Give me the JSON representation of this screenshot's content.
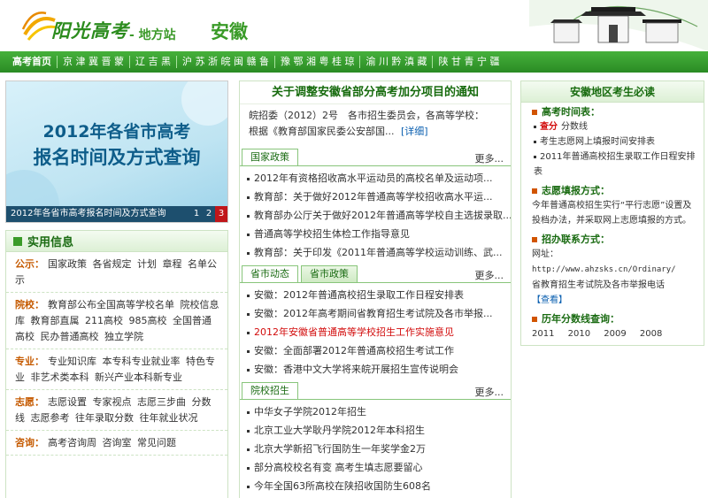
{
  "header": {
    "logo_text": "阳光高考",
    "logo_sub": "- 地方站",
    "province": "安徽"
  },
  "nav": [
    "高考首页",
    "京 津 冀 晋 蒙",
    "辽 吉 黑",
    "沪 苏 浙 皖 闽 赣 鲁",
    "豫 鄂 湘 粤 桂 琼",
    "渝 川 黔 滇 藏",
    "陕 甘 青 宁 疆"
  ],
  "banner": {
    "line1": "2012年各省市高考",
    "line2": "报名时间及方式查询",
    "caption": "2012年各省市高考报名时间及方式查询",
    "pages": [
      "1",
      "2",
      "3"
    ],
    "active_page": 3
  },
  "info": {
    "title": "实用信息",
    "sections": [
      {
        "label": "公示：",
        "links": [
          "国家政策",
          "各省规定",
          "计划",
          "章程",
          "名单公示"
        ]
      },
      {
        "label": "院校：",
        "links": [
          "教育部公布全国高等学校名单",
          "院校信息库",
          "教育部直属",
          "211高校",
          "985高校",
          "全国普通高校",
          "民办普通高校",
          "独立学院"
        ]
      },
      {
        "label": "专业：",
        "links": [
          "专业知识库",
          "本专科专业就业率",
          "特色专业",
          "非艺术类本科",
          "新兴产业本科新专业"
        ]
      },
      {
        "label": "志愿：",
        "links": [
          "志愿设置",
          "专家视点",
          "志愿三步曲",
          "分数线",
          "志愿参考",
          "往年录取分数",
          "往年就业状况"
        ]
      },
      {
        "label": "咨询：",
        "links": [
          "高考咨询周",
          "咨询室",
          "常见问题"
        ]
      }
    ]
  },
  "headline": {
    "title": "关于调整安徽省部分高考加分项目的通知",
    "desc": "皖招委（2012）2号　各市招生委员会，各高等学校：　　根据《教育部国家民委公安部国...",
    "detail": "[详细]"
  },
  "middle": {
    "more": "更多...",
    "sections": [
      {
        "tabs": [
          "国家政策"
        ],
        "items": [
          {
            "text": "2012年有资格招收高水平运动员的高校名单及运动项..."
          },
          {
            "text": "教育部：关于做好2012年普通高等学校招收高水平运..."
          },
          {
            "text": "教育部办公厅关于做好2012年普通高等学校自主选拔录取..."
          },
          {
            "text": "普通高等学校招生体检工作指导意见"
          },
          {
            "text": "教育部：关于印发《2011年普通高等学校运动训练、武..."
          }
        ]
      },
      {
        "tabs": [
          "省市动态",
          "省市政策"
        ],
        "items": [
          {
            "text": "安徽：2012年普通高校招生录取工作日程安排表"
          },
          {
            "text": "安徽：2012年高考期间省教育招生考试院及各市举报..."
          },
          {
            "text": "2012年安徽省普通高等学校招生工作实施意见",
            "red": true
          },
          {
            "text": "安徽：全面部署2012年普通高校招生考试工作"
          },
          {
            "text": "安徽：香港中文大学将来皖开展招生宣传说明会"
          }
        ]
      },
      {
        "tabs": [
          "院校招生"
        ],
        "items": [
          {
            "text": "中华女子学院2012年招生"
          },
          {
            "text": "北京工业大学耿丹学院2012年本科招生"
          },
          {
            "text": "北京大学新招飞行国防生一年奖学金2万"
          },
          {
            "text": "部分高校校名有变 高考生填志愿要留心"
          },
          {
            "text": "今年全国63所高校在陕招收国防生608名"
          }
        ]
      }
    ]
  },
  "right": {
    "title": "安徽地区考生必读",
    "exam_time": {
      "head": "高考时间表：",
      "items": [
        {
          "red": "查分",
          "text": "分数线"
        },
        {
          "text": "考生志愿网上填报时间安排表"
        },
        {
          "text": "2011年普通高校招生录取工作日程安排表"
        }
      ]
    },
    "volunteer": {
      "head": "志愿填报方式：",
      "text": "今年普通高校招生实行“平行志愿”设置及投档办法，并采取网上志愿填报的方式。"
    },
    "contact": {
      "head": "招办联系方式：",
      "prefix": "网址：",
      "url": "http://www.ahzsks.cn/Ordinary/",
      "text": "省教育招生考试院及各市举报电话",
      "link": "【查看】"
    },
    "scores": {
      "head": "历年分数线查询：",
      "years": [
        "2011",
        "2010",
        "2009",
        "2008"
      ]
    }
  },
  "colors": {
    "brand_green": "#3a9b28",
    "nav_green": "#2a8b24",
    "alert_red": "#d20c0c",
    "link_blue": "#0a5fb0"
  }
}
